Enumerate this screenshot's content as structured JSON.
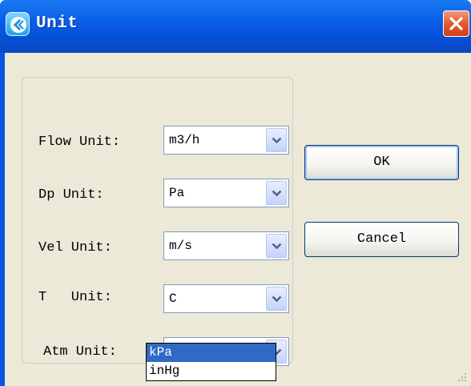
{
  "window": {
    "title": "Unit"
  },
  "fields": [
    {
      "label": "Flow Unit:",
      "value": "m3/h"
    },
    {
      "label": "Dp Unit:",
      "value": "Pa"
    },
    {
      "label": "Vel Unit:",
      "value": "m/s"
    },
    {
      "label": "T   Unit:",
      "value": "C"
    },
    {
      "label": "Atm Unit:",
      "value": "kPa"
    }
  ],
  "buttons": {
    "ok": "OK",
    "cancel": "Cancel"
  },
  "dropdown": {
    "options": [
      "kPa",
      "inHg"
    ],
    "selected_index": 0
  },
  "colors": {
    "titlebar": "#0a5fe6",
    "close": "#e5582e",
    "dialog_bg": "#ece9d8",
    "selection": "#316ac5"
  }
}
